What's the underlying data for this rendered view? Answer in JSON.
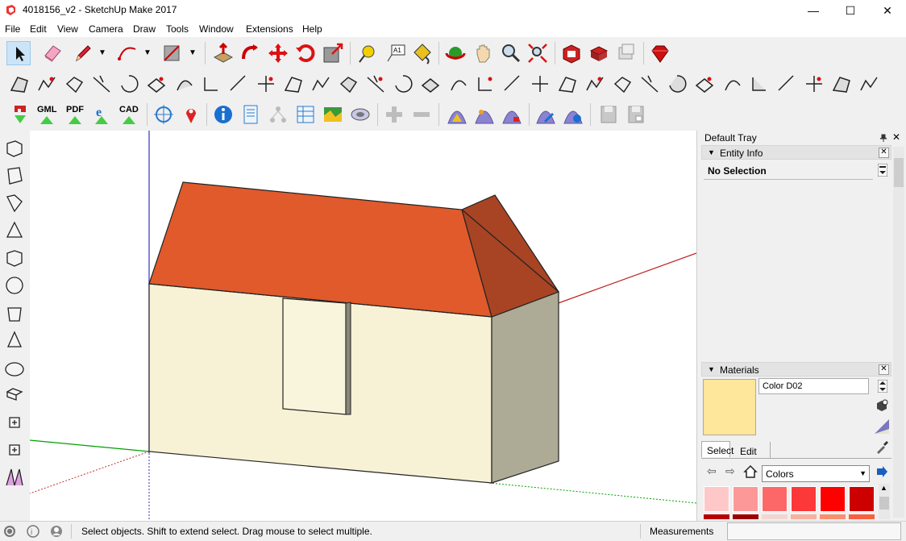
{
  "window": {
    "title": "4018156_v2 - SketchUp Make 2017",
    "minimize": "—",
    "maximize": "☐",
    "close": "✕"
  },
  "menu": [
    "File",
    "Edit",
    "View",
    "Camera",
    "Draw",
    "Tools",
    "Window",
    "Extensions",
    "Help"
  ],
  "toolbar3": {
    "gml": "GML",
    "pdf": "PDF",
    "cad": "CAD"
  },
  "tray": {
    "title": "Default Tray",
    "pin": "▼",
    "entity_info": {
      "label": "Entity Info",
      "selection": "No Selection"
    },
    "materials": {
      "label": "Materials",
      "material_name": "Color D02",
      "tab_select": "Select",
      "tab_edit": "Edit",
      "library": "Colors",
      "swatch_color": "#fee69a",
      "swatches_row1": [
        "#fec8c8",
        "#fd9898",
        "#fc6868",
        "#fc3838",
        "#fd0000",
        "#cd0000"
      ],
      "swatches_row2": [
        "#b80000",
        "#9a0000",
        "#f4d6d0",
        "#f8b0a0",
        "#f89070",
        "#f86040"
      ]
    }
  },
  "status": {
    "hint": "Select objects. Shift to extend select. Drag mouse to select multiple.",
    "measurements_label": "Measurements",
    "measurements_value": ""
  },
  "colors": {
    "roof_front": "#e05a2c",
    "roof_side": "#a84424",
    "wall_front": "#f7f2d6",
    "wall_side": "#adaa95",
    "door": "#f9f5dc",
    "axis_red": "#c00000",
    "axis_green": "#00a000",
    "axis_blue": "#0000c0"
  }
}
